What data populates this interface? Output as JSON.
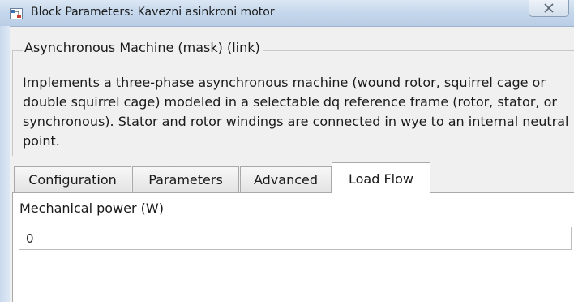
{
  "window": {
    "title": "Block Parameters: Kavezni asinkroni motor"
  },
  "mask": {
    "legend": "Asynchronous Machine (mask) (link)",
    "description": "Implements a three-phase asynchronous machine (wound rotor, squirrel cage or double squirrel cage) modeled in a selectable dq reference frame (rotor, stator, or synchronous). Stator and rotor windings are connected in wye to an internal neutral point."
  },
  "tabs": [
    {
      "label": "Configuration",
      "active": false
    },
    {
      "label": "Parameters",
      "active": false
    },
    {
      "label": "Advanced",
      "active": false
    },
    {
      "label": "Load Flow",
      "active": true
    }
  ],
  "load_flow": {
    "mechanical_power_label": "Mechanical power (W)",
    "mechanical_power_value": "0"
  },
  "icons": {
    "app": "simulink-block-icon",
    "close": "close-icon"
  }
}
